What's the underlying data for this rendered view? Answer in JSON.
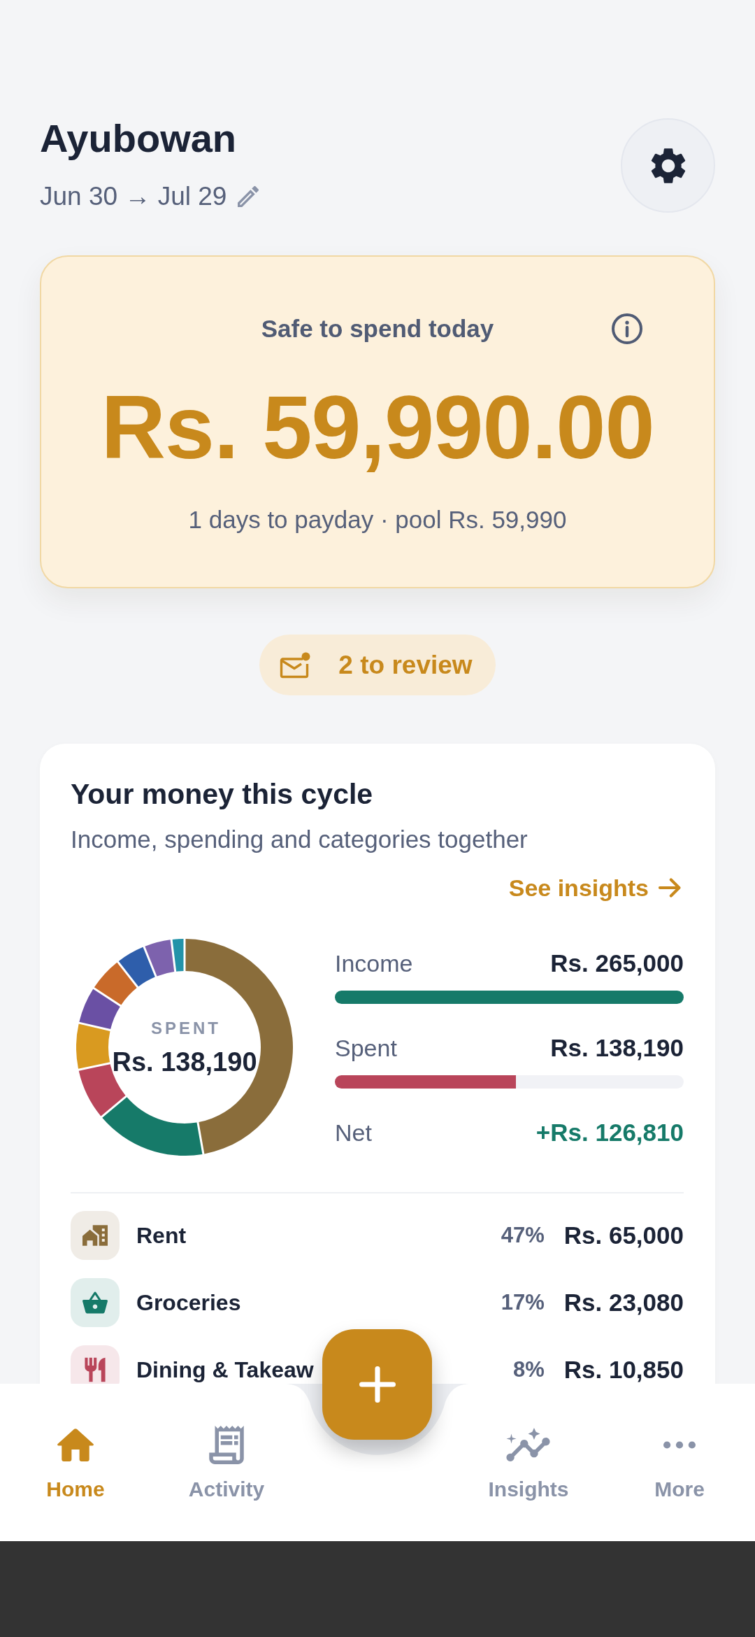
{
  "header": {
    "greeting": "Ayubowan",
    "period": "Jun 30 → Jul 29"
  },
  "safe_to_spend": {
    "label": "Safe to spend today",
    "amount": "Rs. 59,990.00",
    "detail": "1 days to payday · pool Rs. 59,990"
  },
  "review": {
    "label": "2 to review"
  },
  "money_card": {
    "title": "Your money this cycle",
    "subtitle": "Income, spending and categories together",
    "link": "See insights",
    "donut": {
      "caption": "SPENT",
      "total": "Rs. 138,190"
    },
    "summary": [
      {
        "kind": "bar",
        "label": "Income",
        "value": "Rs. 265,000",
        "level": 1,
        "color": "#167a69"
      },
      {
        "kind": "bar",
        "label": "Spent",
        "value": "Rs. 138,190",
        "level": 0.52,
        "color": "#b9455a"
      },
      {
        "kind": "total",
        "label": "Net",
        "value": "+Rs. 126,810",
        "color": "#167a69"
      }
    ],
    "categories": [
      {
        "name": "Rent",
        "percent": "47%",
        "amount": "Rs. 65,000",
        "color": "#8a6d3b"
      },
      {
        "name": "Groceries",
        "percent": "17%",
        "amount": "Rs. 23,080",
        "color": "#167a69"
      },
      {
        "name": "Dining & Takeaw",
        "percent": "8%",
        "amount": "Rs. 10,850",
        "color": "#b9455a"
      }
    ]
  },
  "nav": [
    {
      "label": "Home",
      "selected": true
    },
    {
      "label": "Activity",
      "selected": false
    },
    {
      "label": "Insights",
      "selected": false
    },
    {
      "label": "More",
      "selected": false
    }
  ]
}
